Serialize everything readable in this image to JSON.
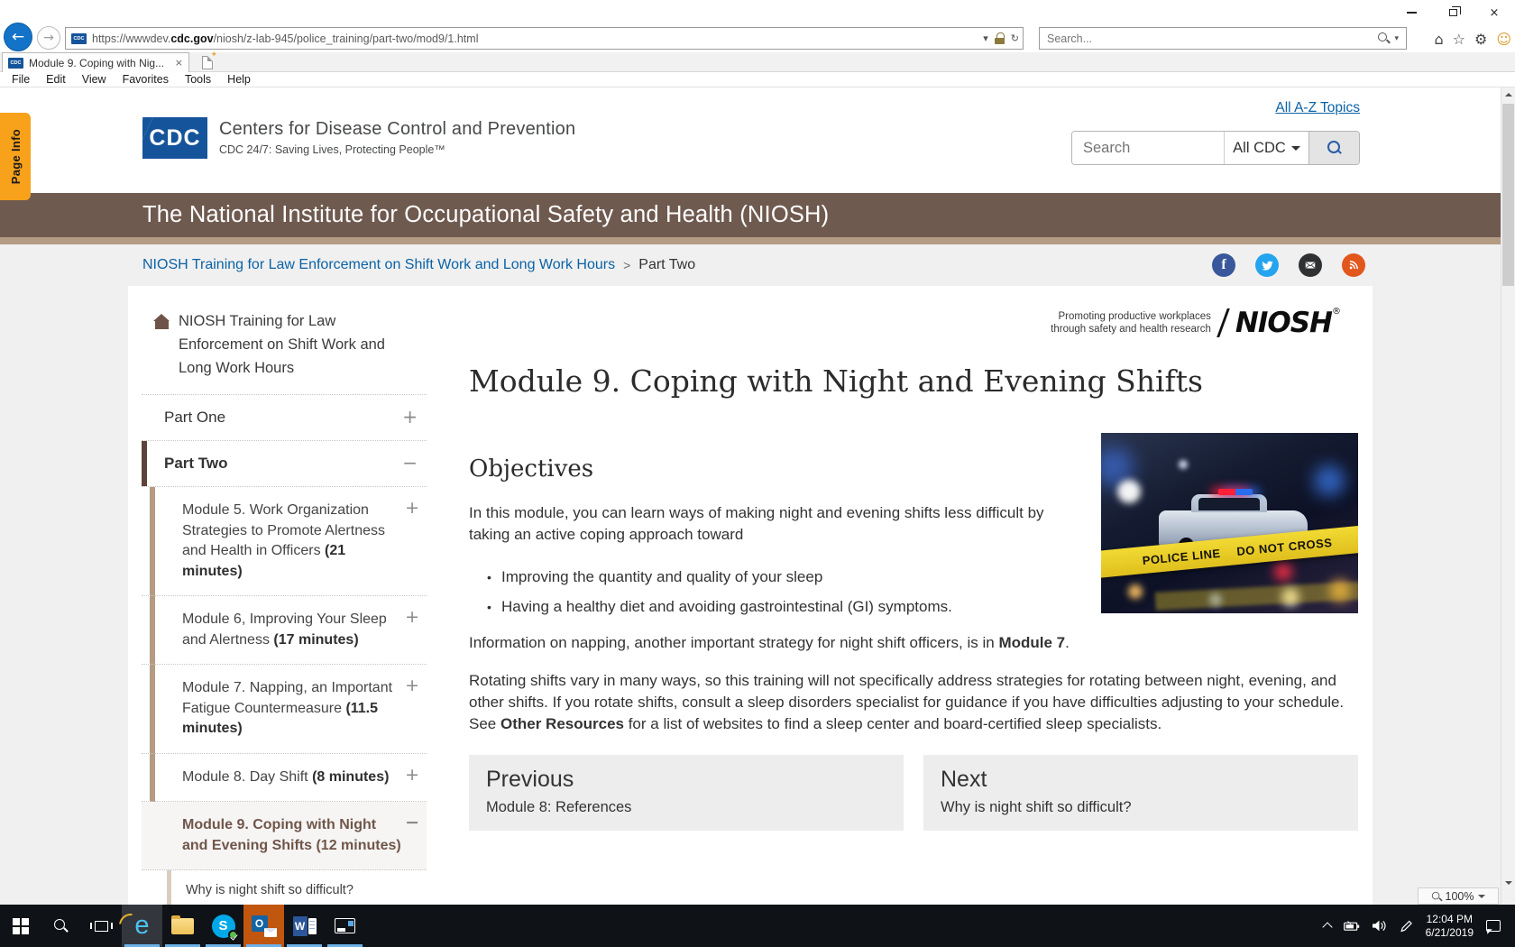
{
  "browser": {
    "favicon_label": "CDC",
    "tab_title": "Module 9. Coping with Nig...",
    "close_glyph": "×",
    "back_glyph": "←",
    "forward_glyph": "→",
    "refresh_glyph": "↻",
    "url_prefix": "https://wwwdev.",
    "url_domain": "cdc.gov",
    "url_path": "/niosh/z-lab-945/police_training/part-two/mod9/1.html",
    "url_search_placeholder": "Search...",
    "menu": [
      "File",
      "Edit",
      "View",
      "Favorites",
      "Tools",
      "Help"
    ],
    "home_glyph": "⌂",
    "star_glyph": "☆",
    "gear_glyph": "⚙",
    "smiley_glyph": "☺",
    "zoom_level": "100%"
  },
  "page_info_tab": "Page Info",
  "header": {
    "az_link": "All A-Z Topics",
    "logo_acronym": "CDC",
    "org_name": "Centers for Disease Control and Prevention",
    "tagline": "CDC 24/7: Saving Lives, Protecting People™",
    "search_placeholder": "Search",
    "search_scope": "All CDC"
  },
  "banner": {
    "title": "The National Institute for Occupational Safety and Health (NIOSH)"
  },
  "breadcrumb": {
    "trail_link": "NIOSH Training for Law Enforcement on Shift Work and Long Work Hours",
    "separator": ">",
    "current": "Part Two",
    "social": [
      "facebook",
      "twitter",
      "email",
      "syndicate"
    ],
    "facebook_glyph": "f"
  },
  "sidebar": {
    "home": "NIOSH Training for Law Enforcement on Shift Work and Long Work Hours",
    "part_one": {
      "label": "Part One",
      "toggle": "+"
    },
    "part_two": {
      "label": "Part Two",
      "toggle": "−"
    },
    "modules": [
      {
        "title": "Module 5. Work Organization Strategies to Promote Alertness and Health in Officers",
        "time": "(21 minutes)",
        "toggle": "+",
        "active": false
      },
      {
        "title": "Module 6, Improving Your Sleep and Alertness",
        "time": "(17 minutes)",
        "toggle": "+",
        "active": false
      },
      {
        "title": "Module 7. Napping, an Important Fatigue Countermeasure",
        "time": "(11.5 minutes)",
        "toggle": "+",
        "active": false
      },
      {
        "title": "Module 8. Day Shift",
        "time": "(8 minutes)",
        "toggle": "+",
        "active": false
      },
      {
        "title": "Module 9. Coping with Night and Evening Shifts",
        "time": "(12 minutes)",
        "toggle": "−",
        "active": true
      }
    ],
    "subitem": "Why is night shift so difficult?"
  },
  "content": {
    "niosh_logo": {
      "tag_line1": "Promoting productive workplaces",
      "tag_line2": "through safety and health research",
      "logo_text": "NIOSH",
      "reg": "®"
    },
    "h1": "Module 9. Coping with Night and Evening Shifts",
    "h2": "Objectives",
    "p1": "In this module, you can learn ways of making night and evening shifts less difficult by taking an active coping approach toward",
    "bullets": [
      "Improving the quantity and quality of your sleep",
      "Having a healthy diet and avoiding gastrointestinal (GI) symptoms."
    ],
    "p2_pre": "Information on napping, another important strategy for night shift officers, is in ",
    "p2_bold": "Module 7",
    "p2_post": ".",
    "p3_pre": "Rotating shifts vary in many ways, so this training will not specifically address strategies for rotating between night, evening, and other shifts. If you rotate shifts, consult a sleep disorders specialist for guidance if you have difficulties adjusting to your schedule. See ",
    "p3_bold": "Other Resources",
    "p3_post": " for a list of websites to find a sleep center and board-certified sleep specialists.",
    "image_tape_1": "POLICE LINE",
    "image_tape_2": "DO NOT CROSS",
    "prev": {
      "label": "Previous",
      "target": "Module 8: References"
    },
    "next": {
      "label": "Next",
      "target": "Why is night shift so difficult?"
    }
  },
  "taskbar": {
    "apps": [
      {
        "name": "start"
      },
      {
        "name": "search"
      },
      {
        "name": "taskview"
      },
      {
        "name": "ie",
        "glyph": "e",
        "running": true,
        "focused": true
      },
      {
        "name": "explorer",
        "running": true
      },
      {
        "name": "skype",
        "glyph": "S",
        "running": true
      },
      {
        "name": "outlook",
        "glyph": "O",
        "running": true,
        "attention": true
      },
      {
        "name": "word",
        "glyph": "W",
        "running": true
      },
      {
        "name": "window",
        "running": true
      }
    ],
    "tray_time": "12:04 PM",
    "tray_date": "6/21/2019"
  }
}
